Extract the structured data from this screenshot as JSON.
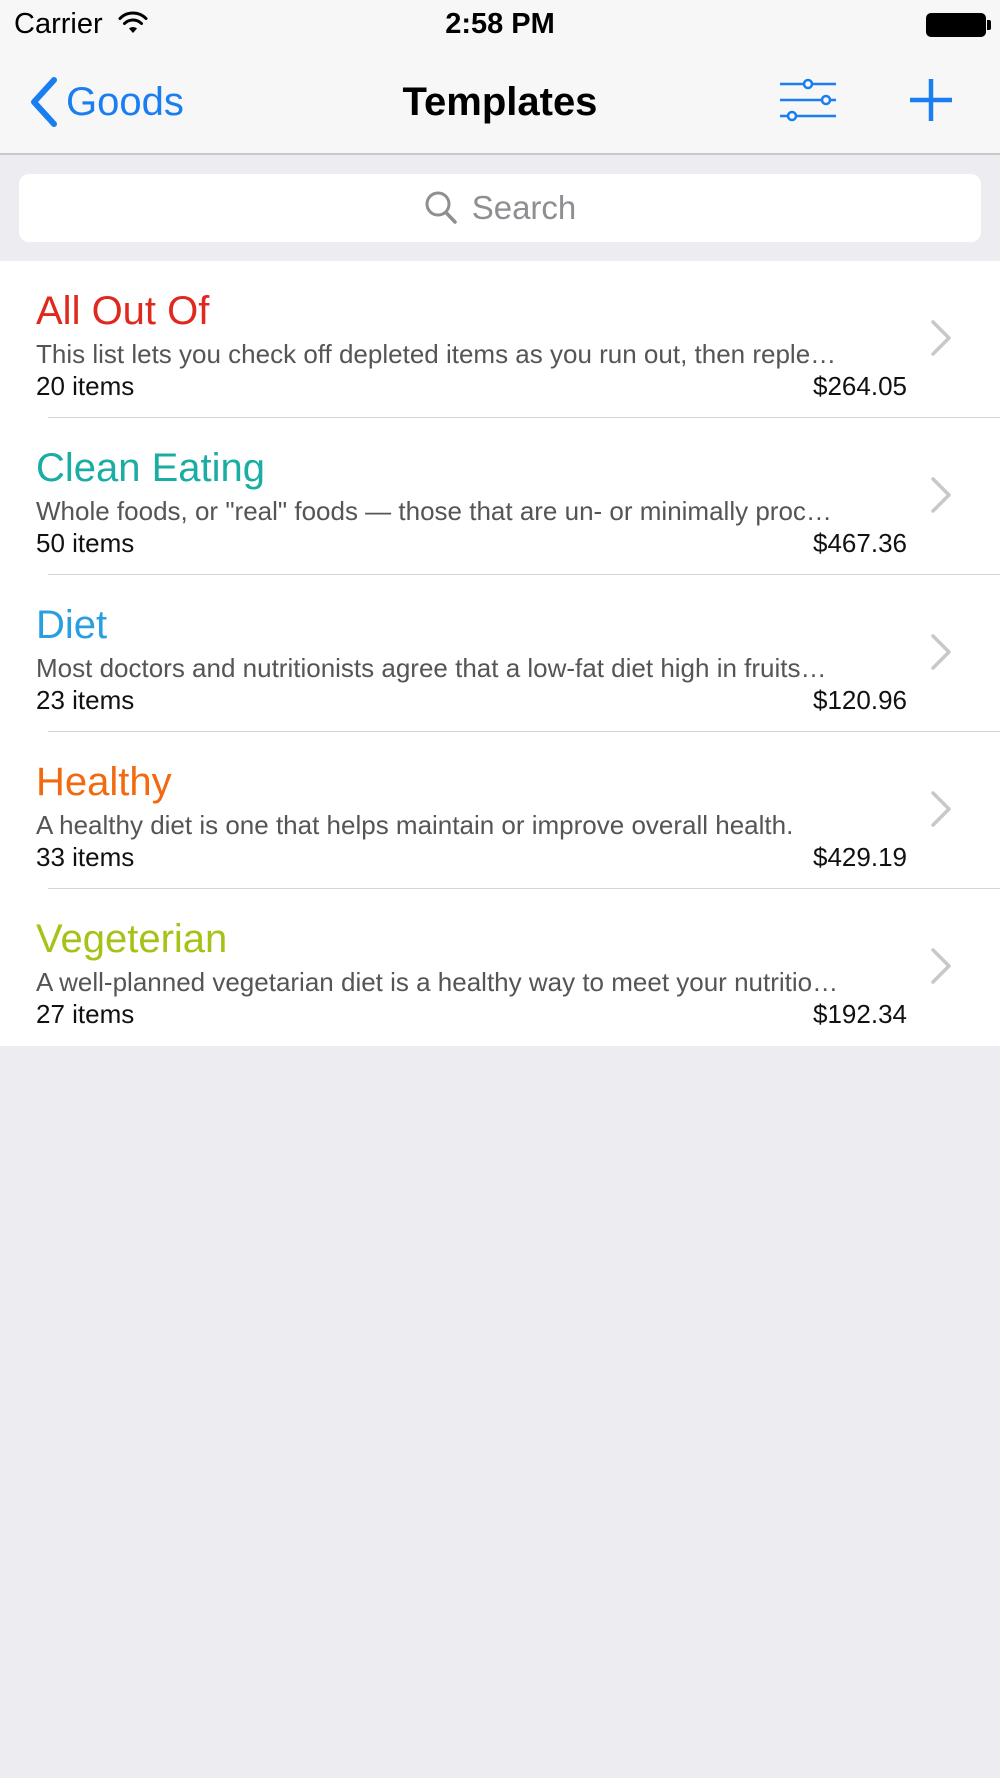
{
  "status_bar": {
    "carrier": "Carrier",
    "time": "2:58 PM"
  },
  "nav_bar": {
    "back_label": "Goods",
    "title": "Templates",
    "accent_color": "#1a7ef0"
  },
  "search": {
    "placeholder": "Search"
  },
  "templates": [
    {
      "title": "All Out Of",
      "color": "#e0281e",
      "description": "This list lets you check off depleted items as you run out, then reple…",
      "count": "20 items",
      "price": "$264.05"
    },
    {
      "title": "Clean Eating",
      "color": "#1aada3",
      "description": "Whole foods, or \"real\" foods — those that are un- or minimally proc…",
      "count": "50 items",
      "price": "$467.36"
    },
    {
      "title": "Diet",
      "color": "#2a9fe0",
      "description": "Most doctors and nutritionists agree that a low-fat diet high in fruits…",
      "count": "23 items",
      "price": "$120.96"
    },
    {
      "title": "Healthy",
      "color": "#f26a10",
      "description": "A healthy diet is one that helps maintain or improve overall health.",
      "count": "33 items",
      "price": "$429.19"
    },
    {
      "title": "Vegeterian",
      "color": "#a5c218",
      "description": "A well-planned vegetarian diet is a healthy way to meet your nutritio…",
      "count": "27 items",
      "price": "$192.34"
    }
  ]
}
